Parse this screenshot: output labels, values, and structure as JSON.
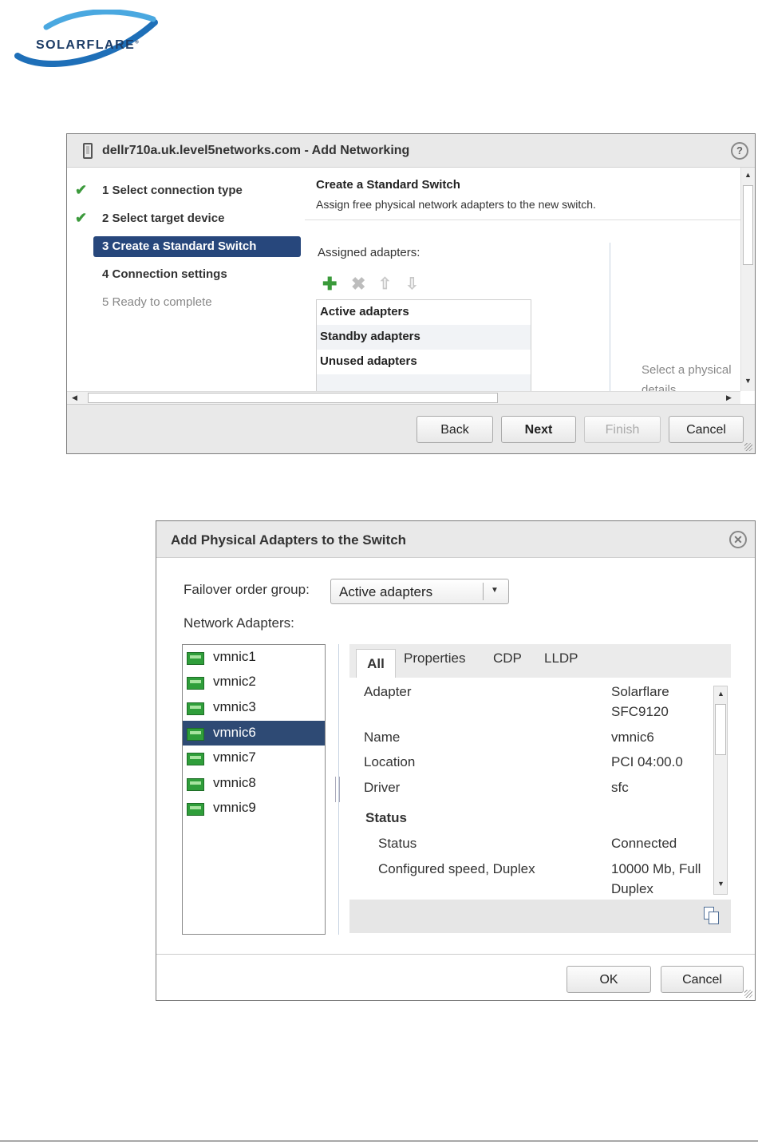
{
  "logo": {
    "text": "SOLARFLARE",
    "reg": "®"
  },
  "add_networking": {
    "title": "dellr710a.uk.level5networks.com - Add Networking",
    "help": "?",
    "steps": [
      {
        "label": "1  Select connection type",
        "state": "done"
      },
      {
        "label": "2  Select target device",
        "state": "done"
      },
      {
        "label": "3  Create a Standard Switch",
        "state": "active"
      },
      {
        "label": "4  Connection settings",
        "state": "pending"
      },
      {
        "label": "5  Ready to complete",
        "state": "disabled"
      }
    ],
    "heading": "Create a Standard Switch",
    "subheading": "Assign free physical network adapters to the new switch.",
    "assigned_label": "Assigned adapters:",
    "adapter_groups": [
      "Active adapters",
      "Standby adapters",
      "Unused adapters"
    ],
    "select_hint_1": "Select a physical",
    "select_hint_2": "details",
    "buttons": {
      "back": "Back",
      "next": "Next",
      "finish": "Finish",
      "cancel": "Cancel"
    }
  },
  "add_adapters": {
    "title": "Add Physical Adapters to the Switch",
    "failover_label": "Failover order group:",
    "failover_value": "Active adapters",
    "network_adapters_label": "Network Adapters:",
    "nics": [
      "vmnic1",
      "vmnic2",
      "vmnic3",
      "vmnic6",
      "vmnic7",
      "vmnic8",
      "vmnic9"
    ],
    "selected_nic": "vmnic6",
    "tabs": [
      "All",
      "Properties",
      "CDP",
      "LLDP"
    ],
    "details": {
      "adapter_key": "Adapter",
      "adapter_val_1": "Solarflare",
      "adapter_val_2": "SFC9120",
      "name_key": "Name",
      "name_val": "vmnic6",
      "location_key": "Location",
      "location_val": "PCI 04:00.0",
      "driver_key": "Driver",
      "driver_val": "sfc",
      "status_heading": "Status",
      "status_key": "Status",
      "status_val": "Connected",
      "speed_key": "Configured speed, Duplex",
      "speed_val_1": "10000 Mb, Full",
      "speed_val_2": "Duplex"
    },
    "buttons": {
      "ok": "OK",
      "cancel": "Cancel"
    }
  }
}
